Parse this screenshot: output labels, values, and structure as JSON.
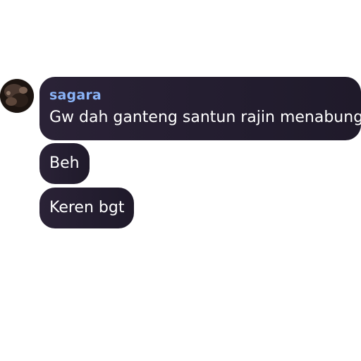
{
  "chat": {
    "sender": {
      "name": "sagara",
      "name_color": "#8ab4f8"
    },
    "messages": [
      {
        "text": "Gw dah ganteng santun rajin menabung"
      },
      {
        "text": "Beh"
      },
      {
        "text": "Keren bgt"
      }
    ],
    "bubble_color": "#261f33",
    "text_color": "#ffffff"
  }
}
